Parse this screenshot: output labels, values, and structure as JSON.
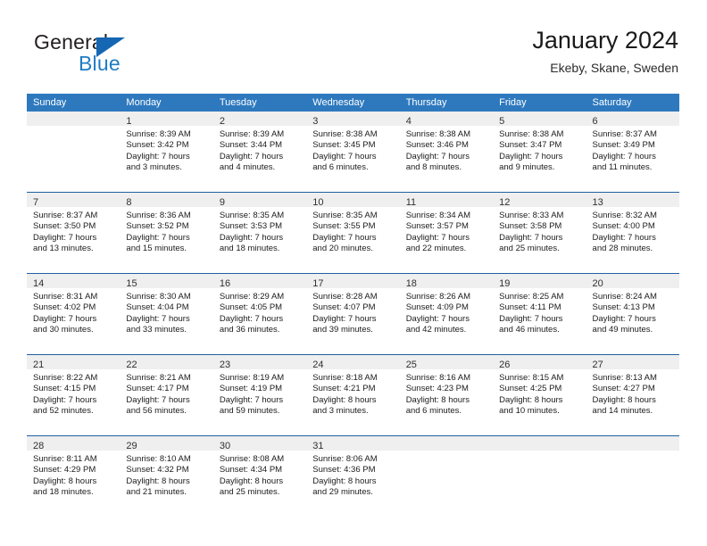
{
  "brand": {
    "name_top": "General",
    "name_bottom": "Blue",
    "accent_color": "#1f7cc4",
    "triangle_color": "#1567b3"
  },
  "header": {
    "title": "January 2024",
    "subtitle": "Ekeby, Skane, Sweden"
  },
  "colors": {
    "header_row_bg": "#2e79be",
    "header_row_text": "#ffffff",
    "week_divider": "#1f5fa0",
    "day_number_band": "#efefef",
    "cell_bg": "#ffffff"
  },
  "weekdays": [
    "Sunday",
    "Monday",
    "Tuesday",
    "Wednesday",
    "Thursday",
    "Friday",
    "Saturday"
  ],
  "weeks": [
    [
      {
        "day": "",
        "sunrise": "",
        "sunset": "",
        "daylight_line1": "",
        "daylight_line2": ""
      },
      {
        "day": "1",
        "sunrise": "Sunrise: 8:39 AM",
        "sunset": "Sunset: 3:42 PM",
        "daylight_line1": "Daylight: 7 hours",
        "daylight_line2": "and 3 minutes."
      },
      {
        "day": "2",
        "sunrise": "Sunrise: 8:39 AM",
        "sunset": "Sunset: 3:44 PM",
        "daylight_line1": "Daylight: 7 hours",
        "daylight_line2": "and 4 minutes."
      },
      {
        "day": "3",
        "sunrise": "Sunrise: 8:38 AM",
        "sunset": "Sunset: 3:45 PM",
        "daylight_line1": "Daylight: 7 hours",
        "daylight_line2": "and 6 minutes."
      },
      {
        "day": "4",
        "sunrise": "Sunrise: 8:38 AM",
        "sunset": "Sunset: 3:46 PM",
        "daylight_line1": "Daylight: 7 hours",
        "daylight_line2": "and 8 minutes."
      },
      {
        "day": "5",
        "sunrise": "Sunrise: 8:38 AM",
        "sunset": "Sunset: 3:47 PM",
        "daylight_line1": "Daylight: 7 hours",
        "daylight_line2": "and 9 minutes."
      },
      {
        "day": "6",
        "sunrise": "Sunrise: 8:37 AM",
        "sunset": "Sunset: 3:49 PM",
        "daylight_line1": "Daylight: 7 hours",
        "daylight_line2": "and 11 minutes."
      }
    ],
    [
      {
        "day": "7",
        "sunrise": "Sunrise: 8:37 AM",
        "sunset": "Sunset: 3:50 PM",
        "daylight_line1": "Daylight: 7 hours",
        "daylight_line2": "and 13 minutes."
      },
      {
        "day": "8",
        "sunrise": "Sunrise: 8:36 AM",
        "sunset": "Sunset: 3:52 PM",
        "daylight_line1": "Daylight: 7 hours",
        "daylight_line2": "and 15 minutes."
      },
      {
        "day": "9",
        "sunrise": "Sunrise: 8:35 AM",
        "sunset": "Sunset: 3:53 PM",
        "daylight_line1": "Daylight: 7 hours",
        "daylight_line2": "and 18 minutes."
      },
      {
        "day": "10",
        "sunrise": "Sunrise: 8:35 AM",
        "sunset": "Sunset: 3:55 PM",
        "daylight_line1": "Daylight: 7 hours",
        "daylight_line2": "and 20 minutes."
      },
      {
        "day": "11",
        "sunrise": "Sunrise: 8:34 AM",
        "sunset": "Sunset: 3:57 PM",
        "daylight_line1": "Daylight: 7 hours",
        "daylight_line2": "and 22 minutes."
      },
      {
        "day": "12",
        "sunrise": "Sunrise: 8:33 AM",
        "sunset": "Sunset: 3:58 PM",
        "daylight_line1": "Daylight: 7 hours",
        "daylight_line2": "and 25 minutes."
      },
      {
        "day": "13",
        "sunrise": "Sunrise: 8:32 AM",
        "sunset": "Sunset: 4:00 PM",
        "daylight_line1": "Daylight: 7 hours",
        "daylight_line2": "and 28 minutes."
      }
    ],
    [
      {
        "day": "14",
        "sunrise": "Sunrise: 8:31 AM",
        "sunset": "Sunset: 4:02 PM",
        "daylight_line1": "Daylight: 7 hours",
        "daylight_line2": "and 30 minutes."
      },
      {
        "day": "15",
        "sunrise": "Sunrise: 8:30 AM",
        "sunset": "Sunset: 4:04 PM",
        "daylight_line1": "Daylight: 7 hours",
        "daylight_line2": "and 33 minutes."
      },
      {
        "day": "16",
        "sunrise": "Sunrise: 8:29 AM",
        "sunset": "Sunset: 4:05 PM",
        "daylight_line1": "Daylight: 7 hours",
        "daylight_line2": "and 36 minutes."
      },
      {
        "day": "17",
        "sunrise": "Sunrise: 8:28 AM",
        "sunset": "Sunset: 4:07 PM",
        "daylight_line1": "Daylight: 7 hours",
        "daylight_line2": "and 39 minutes."
      },
      {
        "day": "18",
        "sunrise": "Sunrise: 8:26 AM",
        "sunset": "Sunset: 4:09 PM",
        "daylight_line1": "Daylight: 7 hours",
        "daylight_line2": "and 42 minutes."
      },
      {
        "day": "19",
        "sunrise": "Sunrise: 8:25 AM",
        "sunset": "Sunset: 4:11 PM",
        "daylight_line1": "Daylight: 7 hours",
        "daylight_line2": "and 46 minutes."
      },
      {
        "day": "20",
        "sunrise": "Sunrise: 8:24 AM",
        "sunset": "Sunset: 4:13 PM",
        "daylight_line1": "Daylight: 7 hours",
        "daylight_line2": "and 49 minutes."
      }
    ],
    [
      {
        "day": "21",
        "sunrise": "Sunrise: 8:22 AM",
        "sunset": "Sunset: 4:15 PM",
        "daylight_line1": "Daylight: 7 hours",
        "daylight_line2": "and 52 minutes."
      },
      {
        "day": "22",
        "sunrise": "Sunrise: 8:21 AM",
        "sunset": "Sunset: 4:17 PM",
        "daylight_line1": "Daylight: 7 hours",
        "daylight_line2": "and 56 minutes."
      },
      {
        "day": "23",
        "sunrise": "Sunrise: 8:19 AM",
        "sunset": "Sunset: 4:19 PM",
        "daylight_line1": "Daylight: 7 hours",
        "daylight_line2": "and 59 minutes."
      },
      {
        "day": "24",
        "sunrise": "Sunrise: 8:18 AM",
        "sunset": "Sunset: 4:21 PM",
        "daylight_line1": "Daylight: 8 hours",
        "daylight_line2": "and 3 minutes."
      },
      {
        "day": "25",
        "sunrise": "Sunrise: 8:16 AM",
        "sunset": "Sunset: 4:23 PM",
        "daylight_line1": "Daylight: 8 hours",
        "daylight_line2": "and 6 minutes."
      },
      {
        "day": "26",
        "sunrise": "Sunrise: 8:15 AM",
        "sunset": "Sunset: 4:25 PM",
        "daylight_line1": "Daylight: 8 hours",
        "daylight_line2": "and 10 minutes."
      },
      {
        "day": "27",
        "sunrise": "Sunrise: 8:13 AM",
        "sunset": "Sunset: 4:27 PM",
        "daylight_line1": "Daylight: 8 hours",
        "daylight_line2": "and 14 minutes."
      }
    ],
    [
      {
        "day": "28",
        "sunrise": "Sunrise: 8:11 AM",
        "sunset": "Sunset: 4:29 PM",
        "daylight_line1": "Daylight: 8 hours",
        "daylight_line2": "and 18 minutes."
      },
      {
        "day": "29",
        "sunrise": "Sunrise: 8:10 AM",
        "sunset": "Sunset: 4:32 PM",
        "daylight_line1": "Daylight: 8 hours",
        "daylight_line2": "and 21 minutes."
      },
      {
        "day": "30",
        "sunrise": "Sunrise: 8:08 AM",
        "sunset": "Sunset: 4:34 PM",
        "daylight_line1": "Daylight: 8 hours",
        "daylight_line2": "and 25 minutes."
      },
      {
        "day": "31",
        "sunrise": "Sunrise: 8:06 AM",
        "sunset": "Sunset: 4:36 PM",
        "daylight_line1": "Daylight: 8 hours",
        "daylight_line2": "and 29 minutes."
      },
      {
        "day": "",
        "sunrise": "",
        "sunset": "",
        "daylight_line1": "",
        "daylight_line2": ""
      },
      {
        "day": "",
        "sunrise": "",
        "sunset": "",
        "daylight_line1": "",
        "daylight_line2": ""
      },
      {
        "day": "",
        "sunrise": "",
        "sunset": "",
        "daylight_line1": "",
        "daylight_line2": ""
      }
    ]
  ]
}
